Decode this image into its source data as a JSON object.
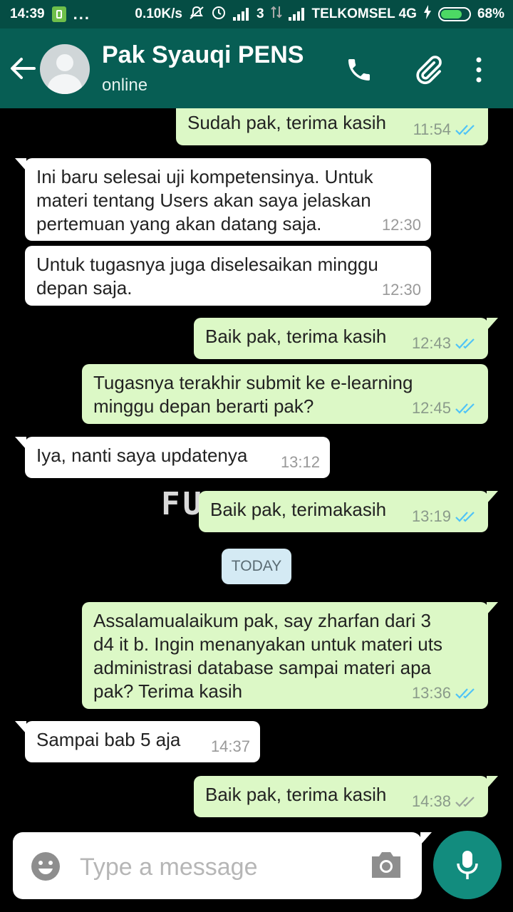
{
  "status_bar": {
    "time": "14:39",
    "dots": "...",
    "speed": "0.10K/s",
    "sim_slot": "3",
    "carrier": "TELKOMSEL 4G",
    "battery": "68%"
  },
  "header": {
    "contact_name": "Pak Syauqi PENS",
    "contact_status": "online"
  },
  "messages": [
    {
      "dir": "out",
      "text": "Sudah pak, terima kasih",
      "time": "11:54",
      "ticks": "read"
    },
    {
      "dir": "in",
      "text": "Ini baru selesai uji kompetensinya. Untuk\nmateri tentang Users akan saya jelaskan\npertemuan yang akan datang saja.",
      "time": "12:30"
    },
    {
      "dir": "in",
      "text": "Untuk tugasnya juga diselesaikan minggu\ndepan saja.",
      "time": "12:30"
    },
    {
      "dir": "out",
      "text": "Baik pak, terima kasih",
      "time": "12:43",
      "ticks": "read"
    },
    {
      "dir": "out",
      "text": "Tugasnya terakhir submit ke e-learning\nminggu depan berarti pak?",
      "time": "12:45",
      "ticks": "read"
    },
    {
      "dir": "in",
      "text": "Iya, nanti saya updatenya",
      "time": "13:12"
    },
    {
      "dir": "out",
      "text": "Baik pak, terimakasih",
      "time": "13:19",
      "ticks": "read"
    },
    {
      "dir": "out",
      "text": "Assalamualaikum pak, say zharfan dari 3\nd4 it b. Ingin menanyakan untuk materi uts\nadministrasi database sampai materi apa\npak? Terima kasih",
      "time": "13:36",
      "ticks": "read"
    },
    {
      "dir": "in",
      "text": "Sampai bab 5 aja",
      "time": "14:37"
    },
    {
      "dir": "out",
      "text": "Baik pak, terima kasih",
      "time": "14:38",
      "ticks": "delivered"
    }
  ],
  "date_separator": "TODAY",
  "watermark": "FU",
  "input": {
    "placeholder": "Type a message"
  },
  "colors": {
    "header": "#075e54",
    "status_bar": "#054d44",
    "outgoing_bubble": "#dcf8c6",
    "incoming_bubble": "#ffffff",
    "read_ticks": "#4fc3f7",
    "delivered_ticks": "#9aa59a",
    "mic_button": "#128c7e"
  }
}
